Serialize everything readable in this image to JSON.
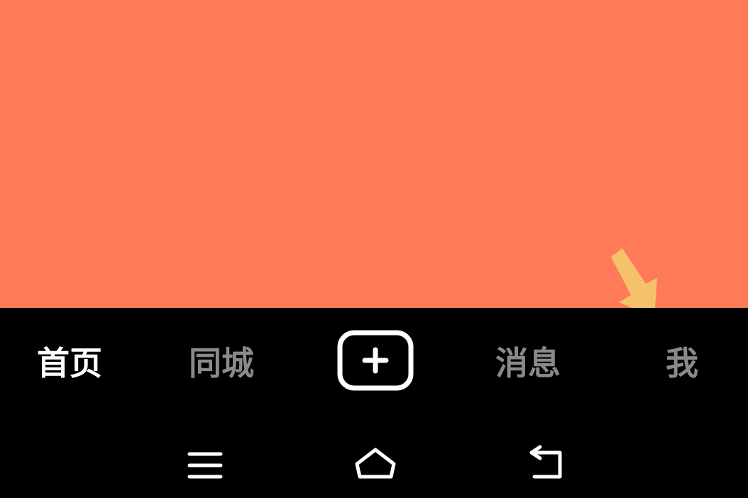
{
  "colors": {
    "content_background": "#FF7A59",
    "tab_active": "#FFFFFF",
    "tab_inactive": "#8A8A8A",
    "hint_arrow": "#F4C26B",
    "bar_background": "#000000"
  },
  "tab_bar": {
    "home_label": "首页",
    "nearby_label": "同城",
    "create_icon": "plus-square-icon",
    "messages_label": "消息",
    "me_label": "我",
    "active_tab": "首页"
  },
  "system_nav": {
    "menu_icon": "menu-icon",
    "home_icon": "home-icon",
    "back_icon": "back-icon"
  },
  "annotation": {
    "icon": "arrow-down-right-icon"
  }
}
